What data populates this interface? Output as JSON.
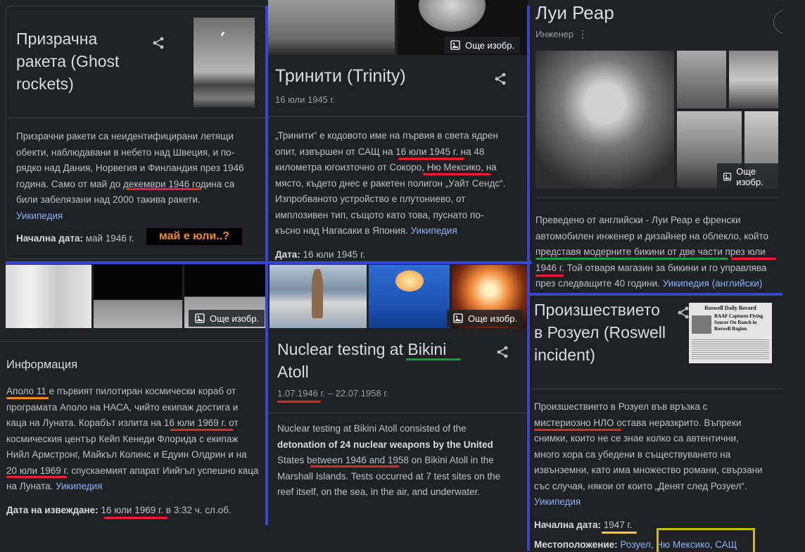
{
  "ghost": {
    "title_lines": [
      "Призрачна",
      "ракета (Ghost",
      "rockets)"
    ],
    "body_lines": [
      "Призрачни ракети са неидентифицирани летящи",
      "обекти, наблюдавани в небето над Швеция, и по-",
      "рядко над Дания, Норвегия и Финландия през 1946",
      "година. Само от май до декември 1946 година са",
      "били забелязани над 2000 такива ракети."
    ],
    "source": "Уикипедия",
    "start_label": "Начална дата:",
    "start_value": "май 1946 г.",
    "note": "май е юли..?"
  },
  "trinity": {
    "title": "Тринити (Trinity)",
    "date": "16 юли 1945 г.",
    "more_images": "Още изобр.",
    "body_lines": [
      "„Тринити“ е кодовото име на първия в света ядрен",
      "опит, извършен от САЩ на 16 юли 1945 г. на 48",
      "километра югоизточно от Сокоро, Ню Мексико, на",
      "място, където днес е ракетен полигон „Уайт Сендс“.",
      "Изпробваното устройство е плутониево, от",
      "имплозивен тип, същото като това, пуснато по-",
      "късно над Нагасаки в Япония."
    ],
    "source": "Уикипедия",
    "fact_label": "Дата:",
    "fact_value": "16 юли 1945 г."
  },
  "reard": {
    "title": "Луи Реар",
    "subtitle": "Инженер",
    "more_images": "Още изобр.",
    "body_lines": [
      "Преведено от английски - Луи Реар е френски",
      "автомобилен инженер и дизайнер на облекло, който",
      "представя модерните бикини от две части през юли",
      "1946 г. Той отваря магазин за бикини и го управлява",
      "през следващите 40 години."
    ],
    "source": "Уикипедия (английски)"
  },
  "apollo": {
    "more_images": "Още изобр.",
    "heading": "Информация",
    "body_lines": [
      "Аполо 11 е първият пилотиран космически кораб от",
      "програмата Аполо на НАСА, чийто екипаж достига и",
      "каца на Луната. Корабът излита на 16 юли 1969 г. от",
      "космическия център Кейп Кенеди Флорида с екипаж",
      "Нийл Армстронг, Майкъл Колинс и Едуин Олдрин и на",
      "20 юли 1969 г. спускаемият апарат Иийгъл успешно каца",
      "на Луната."
    ],
    "source": "Уикипедия",
    "fact_label": "Дата на извеждане:",
    "fact_value": "16 юли 1969 г. в 3:32 ч. сл.об."
  },
  "bikini": {
    "more_images": "Още изобр.",
    "title_lines": [
      "Nuclear testing at Bikini",
      "Atoll"
    ],
    "date": "1.07.1946 г. – 22.07.1958 г.",
    "body_lines": [
      "Nuclear testing at Bikini Atoll consisted of the",
      "detonation of 24 nuclear weapons by the United",
      "States between 1946 and 1958 on Bikini Atoll in the",
      "Marshall Islands. Tests occurred at 7 test sites on the",
      "reef itself, on the sea, in the air, and underwater."
    ]
  },
  "roswell": {
    "title_lines": [
      "Произшествието",
      "в Розуел (Roswell",
      "incident)"
    ],
    "body_lines": [
      "Произшествието в Розуел във връзка с",
      "мистериозно НЛО остава неразкрито. Въпреки",
      "снимки, които не се знае колко са автентични,",
      "много хора са убедени в съществуването на",
      "извънземни, като има множество романи, свързани",
      "със случая, някои от които „Денят след Розуел“."
    ],
    "source": "Уикипедия",
    "start_label": "Начална дата:",
    "start_value": "1947 г.",
    "loc_label": "Местоположение:",
    "loc_value": "Розуел, Ню Мексико, САЩ",
    "newspaper": "Roswell Daily Record",
    "headline": "RAAF Captures Flying Saucer On Ranch in Roswell Region"
  },
  "colors": {
    "underline_red": "#e8232a",
    "underline_green": "#1f9a3c",
    "underline_orange": "#f28b21",
    "underline_yellow": "#f1d21c",
    "box_yellow": "#c9b91a",
    "divider_blue": "#3b45c9",
    "note_orange": "#f28b21"
  }
}
